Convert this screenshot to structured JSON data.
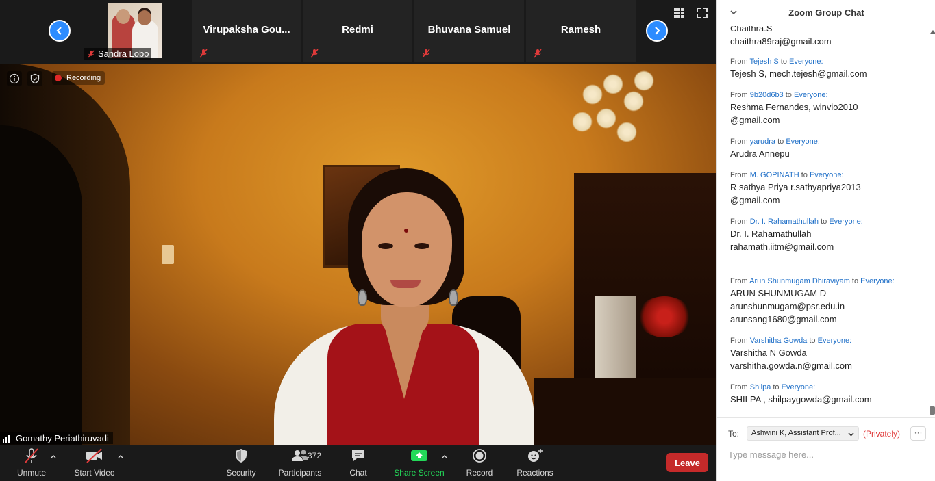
{
  "strip": {
    "participants": [
      {
        "name": "Sandra Lobo"
      },
      {
        "name": "Virupaksha  Gou..."
      },
      {
        "name": "Redmi"
      },
      {
        "name": "Bhuvana Samuel"
      },
      {
        "name": "Ramesh"
      }
    ]
  },
  "video": {
    "recording_label": "Recording",
    "speaker_name": "Gomathy Periathiruvadi"
  },
  "toolbar": {
    "unmute": "Unmute",
    "start_video": "Start Video",
    "security": "Security",
    "participants": "Participants",
    "participant_count": "372",
    "chat": "Chat",
    "share_screen": "Share Screen",
    "record": "Record",
    "reactions": "Reactions",
    "leave": "Leave",
    "share_color": "#23d959",
    "leave_color": "#c52a2a"
  },
  "chat": {
    "title": "Zoom Group Chat",
    "messages": [
      {
        "from": "",
        "to": "",
        "body": [
          "Chaithra.S",
          "chaithra89raj@gmail.com"
        ]
      },
      {
        "from": "Tejesh S",
        "to": "Everyone:",
        "body": [
          "Tejesh S, mech.tejesh@gmail.com"
        ]
      },
      {
        "from": "9b20d6b3",
        "to": "Everyone:",
        "body": [
          "Reshma Fernandes, winvio2010",
          "@gmail.com"
        ]
      },
      {
        "from": "yarudra",
        "to": "Everyone:",
        "body": [
          "Arudra Annepu"
        ]
      },
      {
        "from": "M. GOPINATH",
        "to": "Everyone:",
        "body": [
          "R sathya Priya r.sathyapriya2013",
          "@gmail.com"
        ]
      },
      {
        "from": "Dr. I. Rahamathullah",
        "to": "Everyone:",
        "body": [
          "Dr. I. Rahamathullah",
          "rahamath.iitm@gmail.com"
        ]
      },
      {
        "from": "Arun Shunmugam Dhiraviyam",
        "to": "Everyone:",
        "body": [
          "ARUN SHUNMUGAM D",
          "arunshunmugam@psr.edu.in",
          "arunsang1680@gmail.com"
        ]
      },
      {
        "from": "Varshitha Gowda",
        "to": "Everyone:",
        "body": [
          "Varshitha N Gowda",
          "varshitha.gowda.n@gmail.com"
        ]
      },
      {
        "from": "Shilpa",
        "to": "Everyone:",
        "body": [
          "SHILPA ,  shilpaygowda@gmail.com"
        ]
      }
    ],
    "from_word": "From",
    "to_word": "to",
    "to_label": "To:",
    "recipient": "Ashwini K, Assistant  Prof...",
    "privately": "(Privately)",
    "more": "···",
    "input_placeholder": "Type message here..."
  }
}
